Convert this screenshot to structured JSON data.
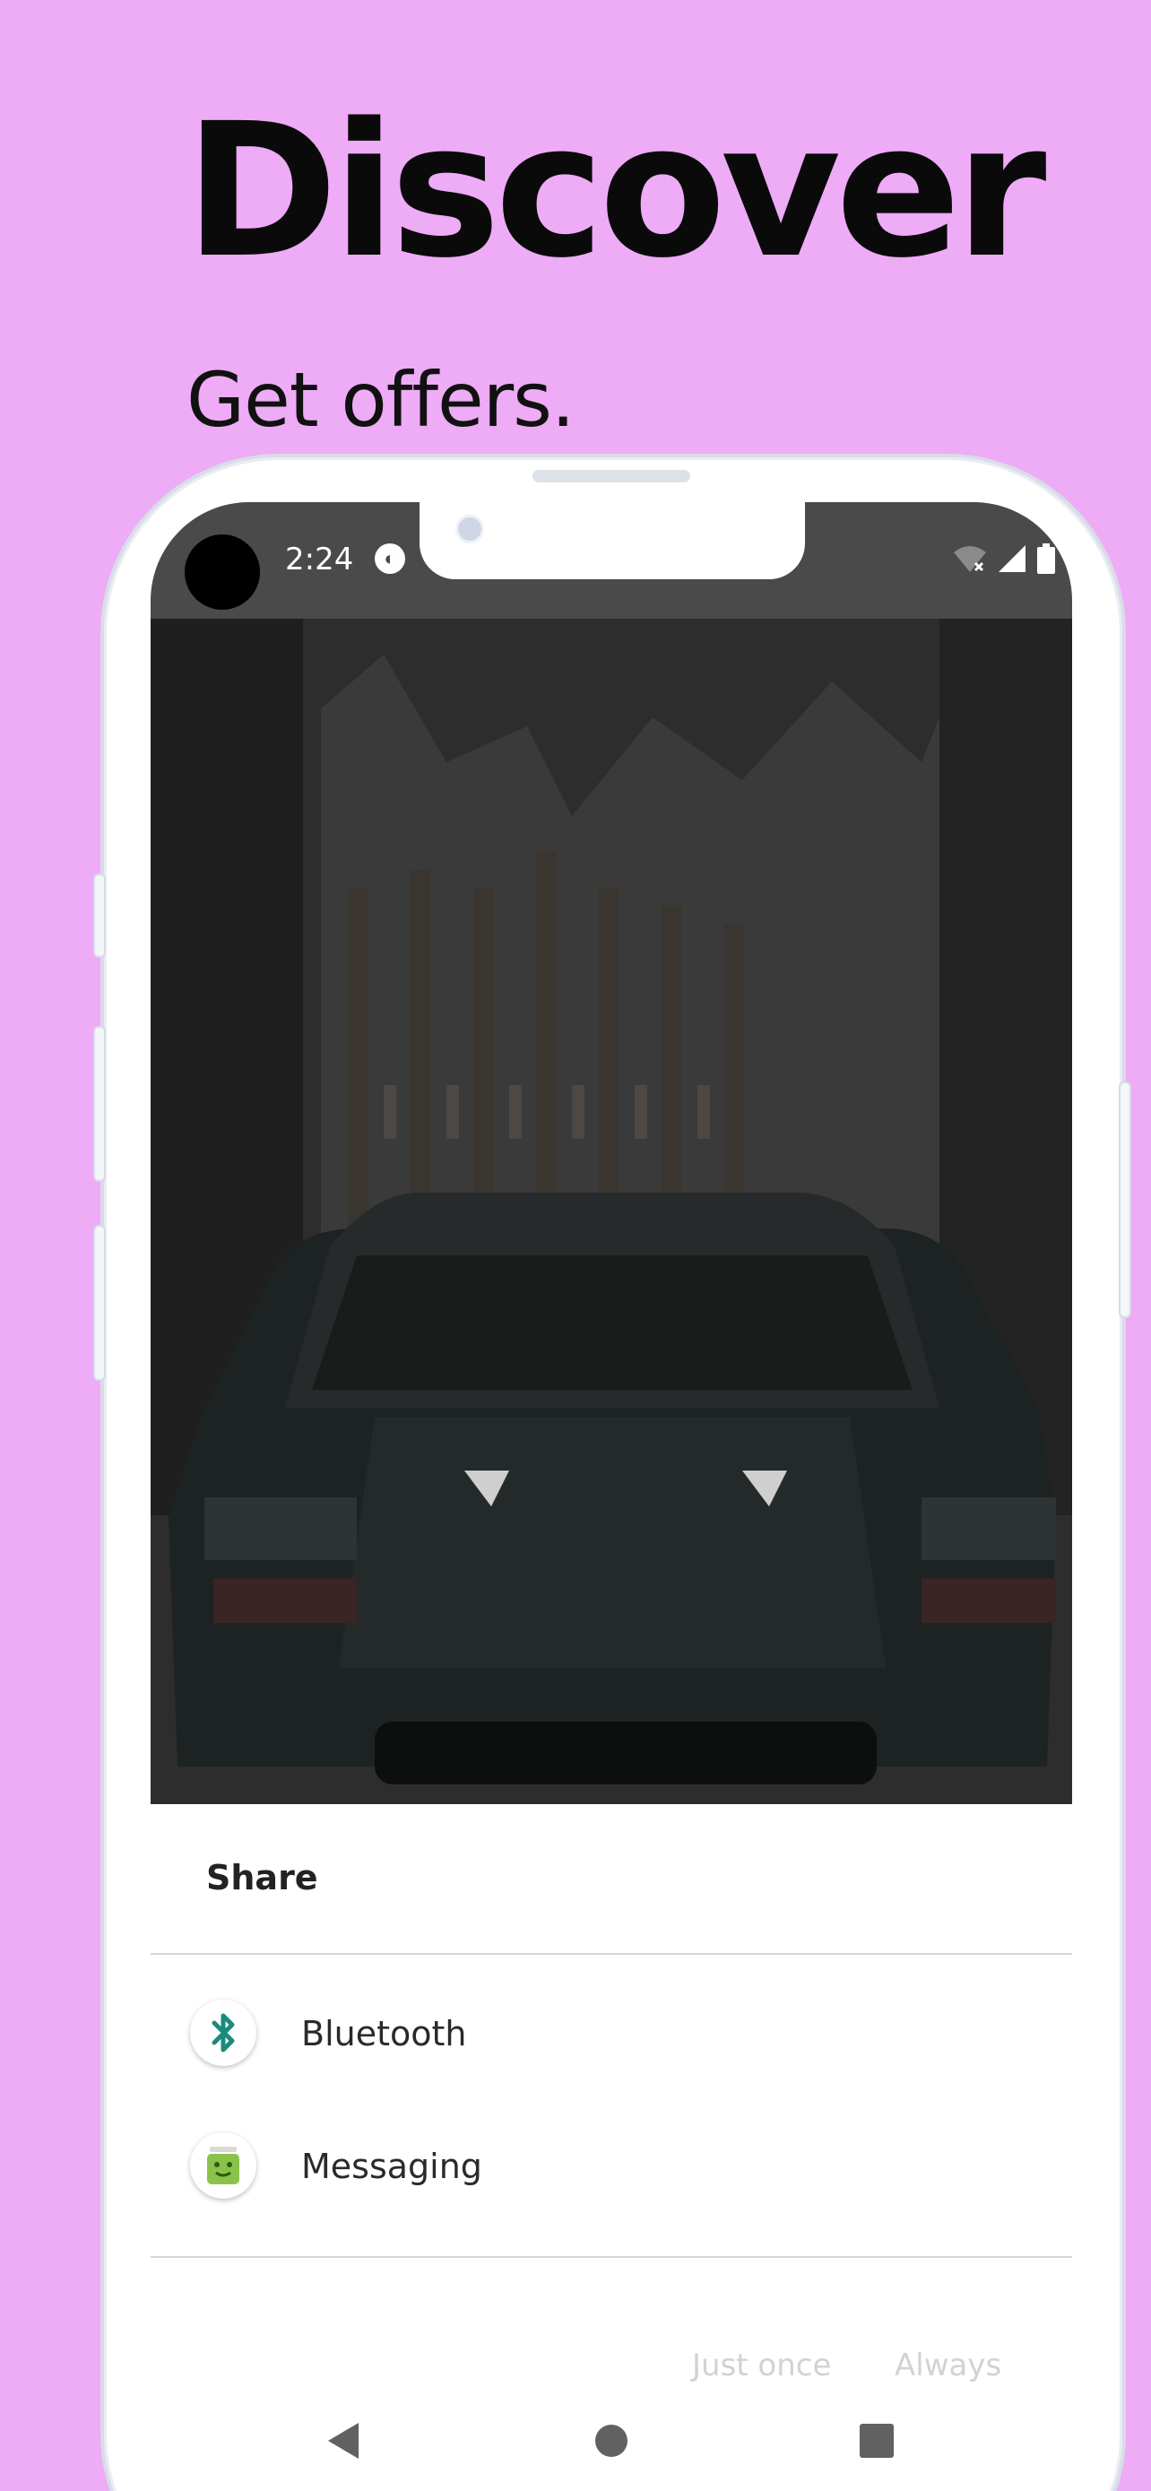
{
  "hero": {
    "title": "Discover",
    "subtitle": "Get offers."
  },
  "status_bar": {
    "time": "2:24",
    "icons": [
      "app-notification-icon",
      "wifi-icon",
      "cellular-signal-icon",
      "battery-icon"
    ]
  },
  "share_sheet": {
    "title": "Share",
    "targets": [
      {
        "label": "Bluetooth",
        "icon": "bluetooth-icon"
      },
      {
        "label": "Messaging",
        "icon": "messaging-icon"
      }
    ],
    "actions": {
      "just_once": "Just once",
      "always": "Always"
    }
  },
  "nav_bar": {
    "buttons": [
      "back-icon",
      "home-icon",
      "recents-icon"
    ]
  },
  "colors": {
    "background": "#eeabf6",
    "status_bar": "#4a4a4a",
    "bluetooth_accent": "#1b8a7e",
    "messaging_accent": "#8bc34a",
    "disabled_text": "#d2d2d2"
  }
}
